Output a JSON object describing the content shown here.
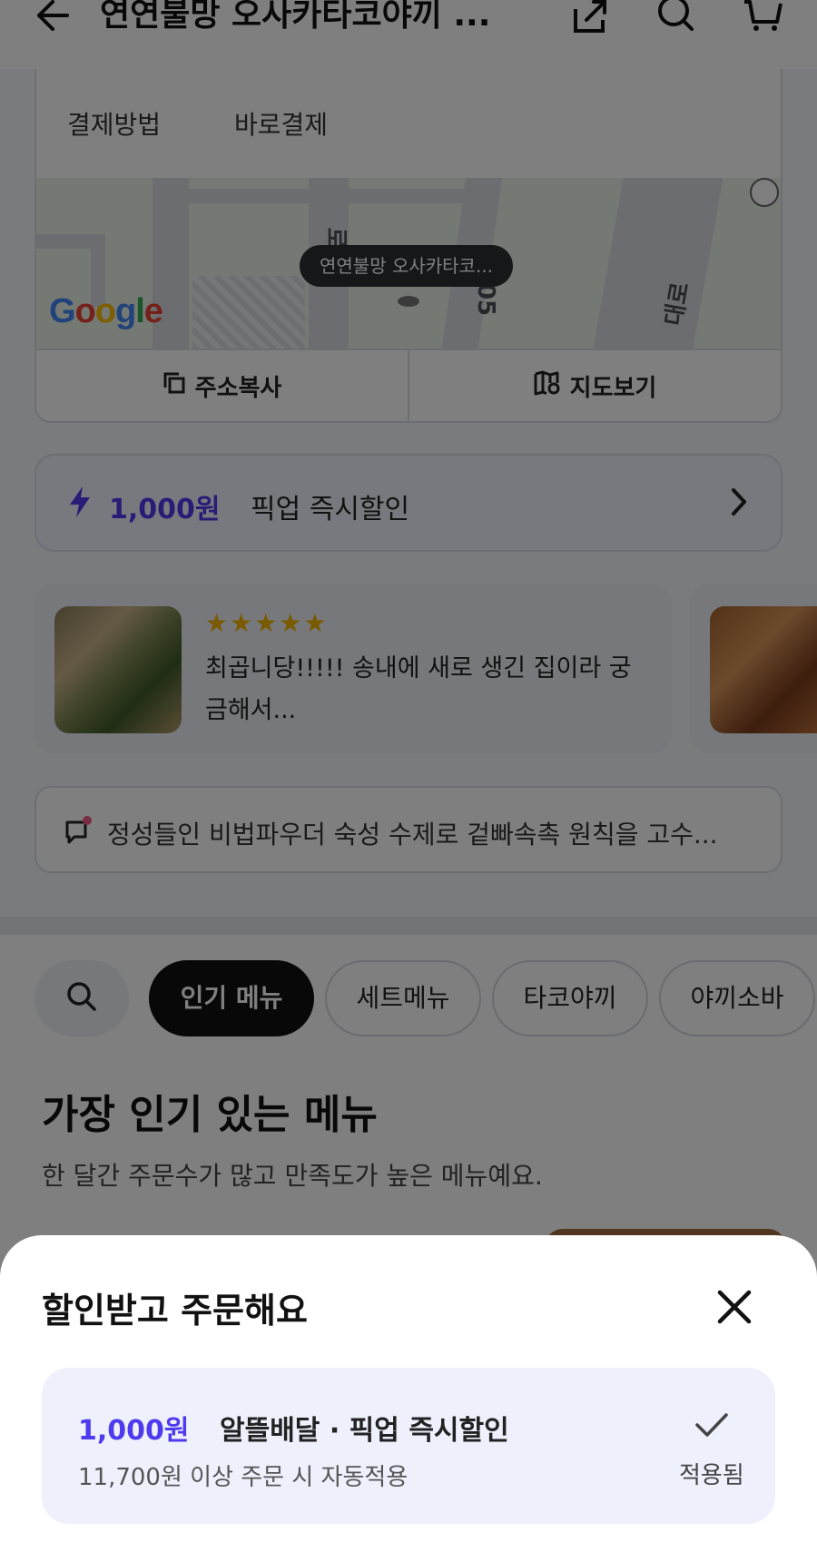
{
  "header": {
    "back_icon": "arrow-left-icon",
    "title": "연연불망 오사카타코야끼 ...",
    "icons": [
      "share-icon",
      "search-icon",
      "cart-icon"
    ]
  },
  "store_info": {
    "payment_label": "결제방법",
    "payment_value": "바로결제",
    "map": {
      "pin_label": "연연불망 오사카타코...",
      "logo": "Google",
      "road_labels": [
        "로19",
        "205",
        "대로"
      ]
    },
    "copy_address_label": "주소복사",
    "view_map_label": "지도보기"
  },
  "pickup_discount": {
    "amount": "1,000원",
    "text": "픽업 즉시할인"
  },
  "reviews": [
    {
      "stars": "★★★★★",
      "text": "최곱니당!!!!! 송내에 새로 생긴 집이라 궁금해서..."
    }
  ],
  "notice": {
    "text": "정성들인 비법파우더 숙성 수제로 겉빠속촉 원칙을 고수..."
  },
  "menu_tabs": [
    "인기 메뉴",
    "세트메뉴",
    "타코야끼",
    "야끼소바"
  ],
  "popular": {
    "title": "가장 인기 있는 메뉴",
    "subtitle": "한 달간 주문수가 많고 만족도가 높은 메뉴예요."
  },
  "sheet": {
    "title": "할인받고 주문해요",
    "offer": {
      "amount": "1,000원",
      "name": "알뜰배달 · 픽업 즉시할인",
      "condition": "11,700원 이상 주문 시 자동적용",
      "status": "적용됨"
    }
  },
  "colors": {
    "accent": "#4e3aef",
    "star": "#f5b400",
    "offer_bg": "#eef0fc"
  }
}
